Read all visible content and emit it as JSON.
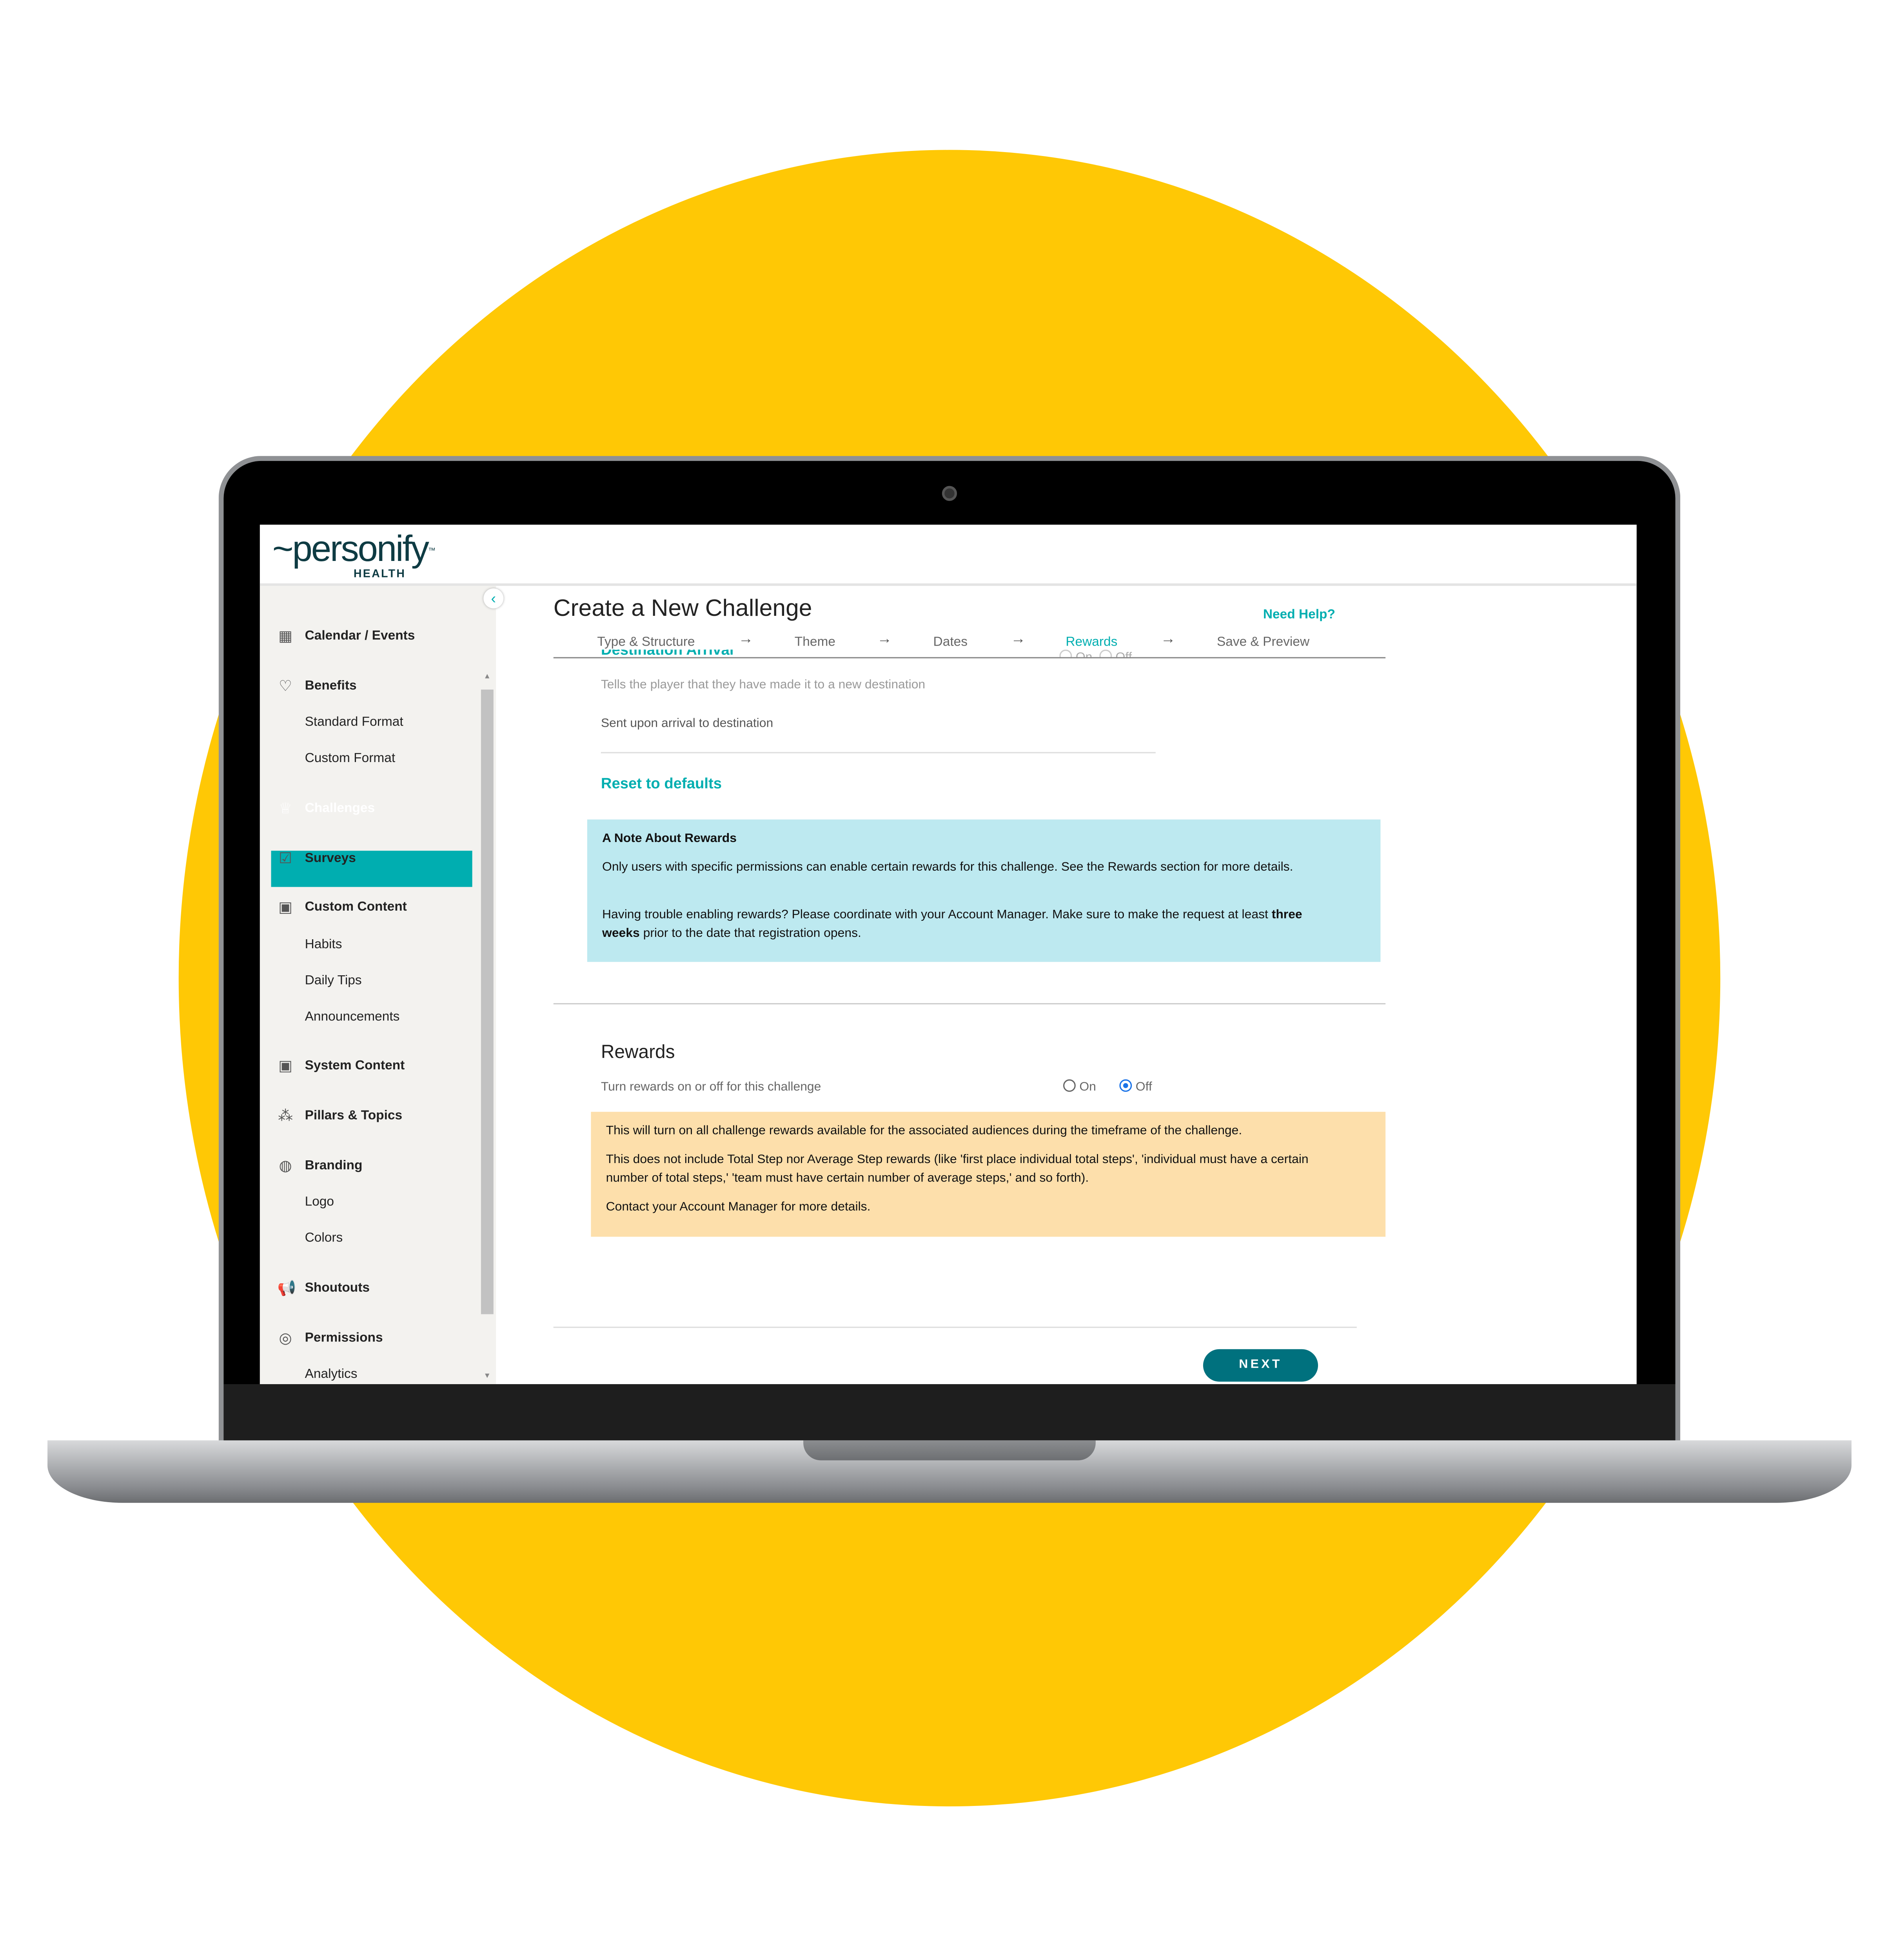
{
  "colors": {
    "background_blob": "#ffc805",
    "accent": "#00aeb0",
    "button": "#00717e",
    "note_bg": "#bde9f0",
    "warning_bg": "#fddfab"
  },
  "logo": {
    "word": "personify",
    "sub": "HEALTH",
    "tm": "™"
  },
  "sidebar": {
    "collapse_icon": "chevron-left-icon",
    "items": [
      {
        "label": "Calendar / Events",
        "icon": "calendar-icon",
        "bold": true
      },
      {
        "label": "Benefits",
        "icon": "stethoscope-icon",
        "bold": true
      },
      {
        "label": "Standard Format"
      },
      {
        "label": "Custom Format"
      },
      {
        "label": "Challenges",
        "icon": "trophy-icon",
        "bold": true,
        "active": true
      },
      {
        "label": "Surveys",
        "icon": "clipboard-icon",
        "bold": true
      },
      {
        "label": "Custom Content",
        "icon": "box-icon",
        "bold": true
      },
      {
        "label": "Habits"
      },
      {
        "label": "Daily Tips"
      },
      {
        "label": "Announcements"
      },
      {
        "label": "System Content",
        "icon": "box-icon",
        "bold": true
      },
      {
        "label": "Pillars & Topics",
        "icon": "network-icon",
        "bold": true
      },
      {
        "label": "Branding",
        "icon": "palette-icon",
        "bold": true
      },
      {
        "label": "Logo"
      },
      {
        "label": "Colors"
      },
      {
        "label": "Shoutouts",
        "icon": "megaphone-icon",
        "bold": true
      },
      {
        "label": "Permissions",
        "icon": "user-shield-icon",
        "bold": true
      },
      {
        "label": "Analytics"
      }
    ]
  },
  "main": {
    "title": "Create a New Challenge",
    "help": "Need Help?",
    "steps": [
      {
        "label": "Type & Structure"
      },
      {
        "label": "Theme"
      },
      {
        "label": "Dates"
      },
      {
        "label": "Rewards",
        "active": true
      },
      {
        "label": "Save & Preview"
      }
    ],
    "destination": {
      "heading": "Destination Arrival",
      "on": "On",
      "off": "Off",
      "description": "Tells the player that they have made it to a new destination",
      "message": "Sent upon arrival to destination"
    },
    "reset": "Reset to defaults",
    "note": {
      "title": "A Note About Rewards",
      "p1": "Only users with specific permissions can enable certain rewards for this challenge. See the Rewards section for more details.",
      "p2_pre": "Having trouble enabling rewards? Please coordinate with your Account Manager. Make sure to make the request at least ",
      "p2_bold": "three weeks",
      "p2_post": " prior to the date that registration opens."
    },
    "rewards": {
      "title": "Rewards",
      "description": "Turn rewards on or off for this challenge",
      "on": "On",
      "off": "Off",
      "selected": "Off",
      "warn1": "This will turn on all challenge rewards available for the associated audiences during the timeframe of the challenge.",
      "warn2": "This does not include Total Step nor Average Step rewards (like 'first place individual total steps', 'individual must have a certain number of total steps,' 'team must have certain number of average steps,' and so forth).",
      "warn3": "Contact your Account Manager for more details."
    },
    "next": "NEXT"
  }
}
